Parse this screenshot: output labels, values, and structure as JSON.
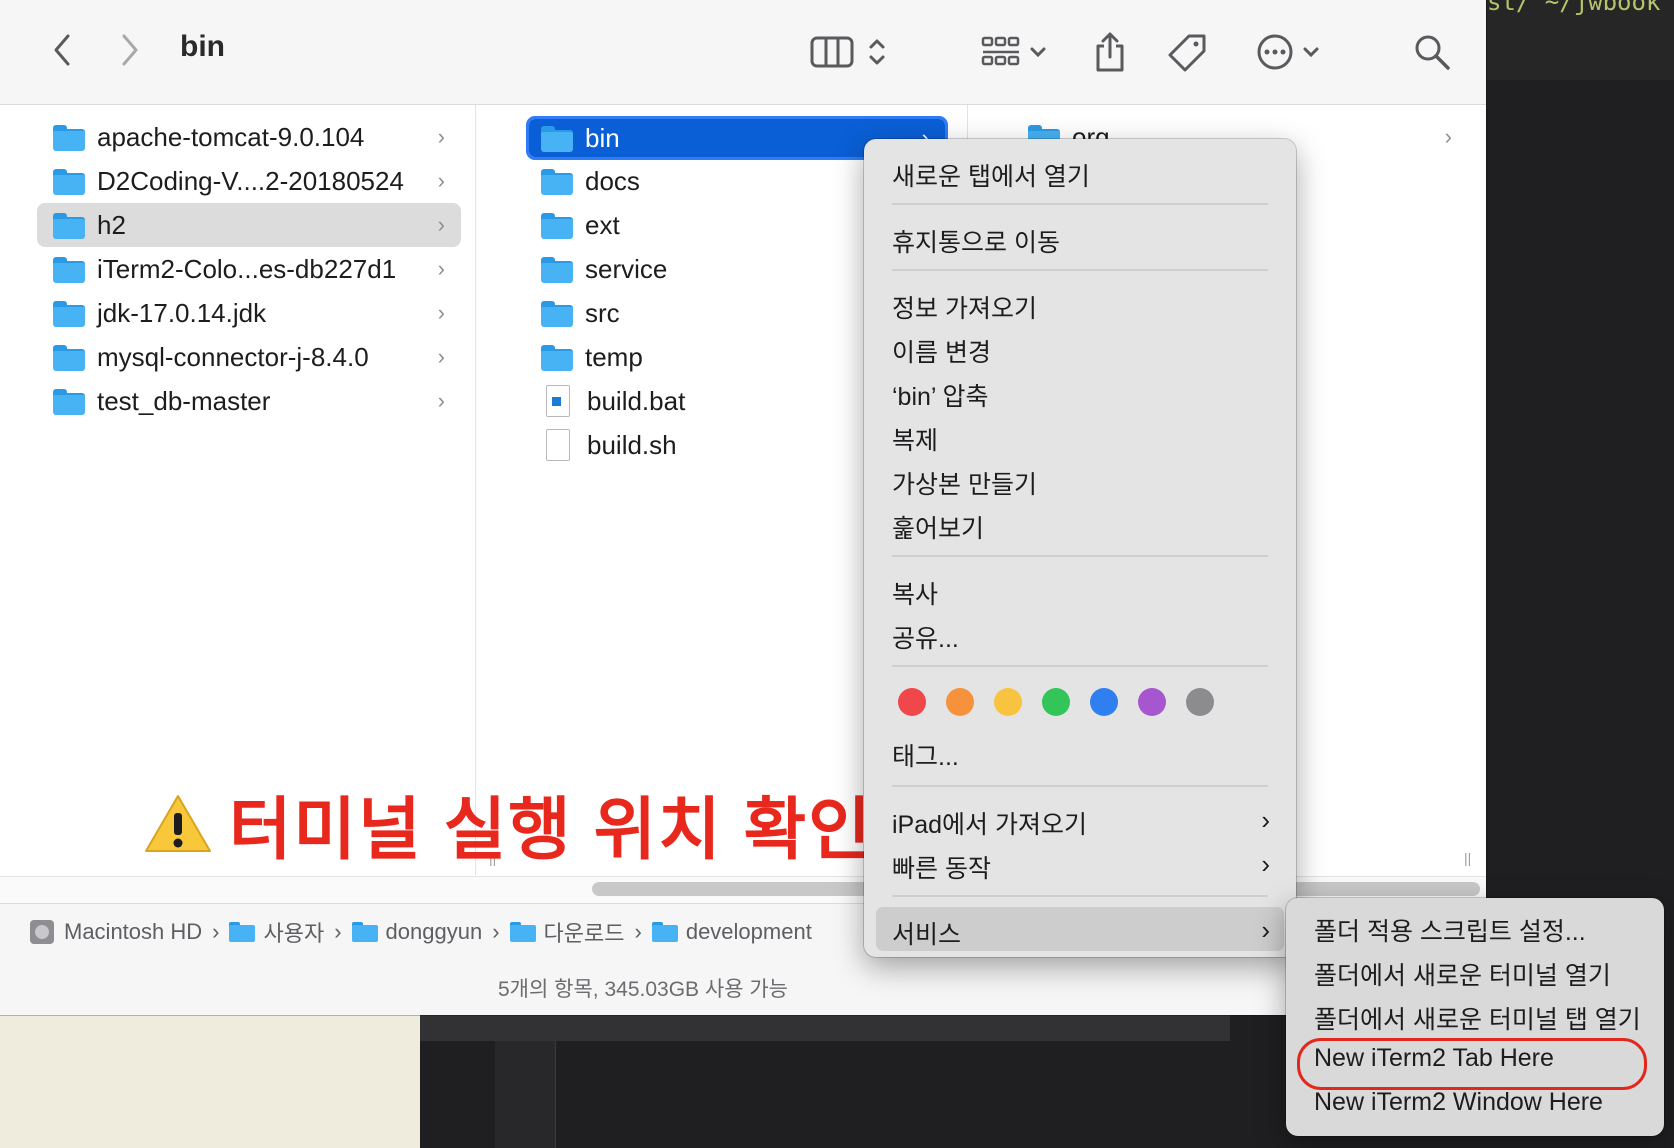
{
  "finder": {
    "title": "bin",
    "column1": [
      {
        "label": "apache-tomcat-9.0.104"
      },
      {
        "label": "D2Coding-V....2-20180524"
      },
      {
        "label": "h2"
      },
      {
        "label": "iTerm2-Colo...es-db227d1"
      },
      {
        "label": "jdk-17.0.14.jdk"
      },
      {
        "label": "mysql-connector-j-8.4.0"
      },
      {
        "label": "test_db-master"
      }
    ],
    "column2": [
      {
        "label": "bin",
        "type": "folder"
      },
      {
        "label": "docs",
        "type": "folder"
      },
      {
        "label": "ext",
        "type": "folder"
      },
      {
        "label": "service",
        "type": "folder"
      },
      {
        "label": "src",
        "type": "folder"
      },
      {
        "label": "temp",
        "type": "folder"
      },
      {
        "label": "build.bat",
        "type": "file-windows"
      },
      {
        "label": "build.sh",
        "type": "file"
      }
    ],
    "column3": [
      {
        "label": "org"
      }
    ],
    "path": [
      "Macintosh HD",
      "사용자",
      "donggyun",
      "다운로드",
      "development"
    ],
    "status": "5개의 항목, 345.03GB 사용 가능"
  },
  "warning_text": "터미널 실행 위치 확인",
  "background_terminal_text": "st/ ~/jwbook",
  "menu": {
    "open_new_tab": "새로운 탭에서 열기",
    "move_to_trash": "휴지통으로 이동",
    "get_info": "정보 가져오기",
    "rename": "이름 변경",
    "compress": "‘bin’ 압축",
    "duplicate": "복제",
    "make_alias": "가상본 만들기",
    "quick_look": "훑어보기",
    "copy": "복사",
    "share": "공유...",
    "tags": "태그...",
    "import_from_ipad": "iPad에서 가져오기",
    "quick_actions": "빠른 동작",
    "services": "서비스",
    "tag_colors": [
      "#f0474a",
      "#f6923b",
      "#f8c440",
      "#33c45a",
      "#2f7ff0",
      "#a657cf",
      "#8c8c8f"
    ]
  },
  "submenu": {
    "folder_actions": "폴더 적용 스크립트 설정...",
    "new_terminal_at_folder": "폴더에서 새로운 터미널 열기",
    "new_terminal_tab_at_folder": "폴더에서 새로운 터미널 탭 열기",
    "new_iterm2_tab": "New iTerm2 Tab Here",
    "new_iterm2_window": "New iTerm2 Window Here"
  }
}
